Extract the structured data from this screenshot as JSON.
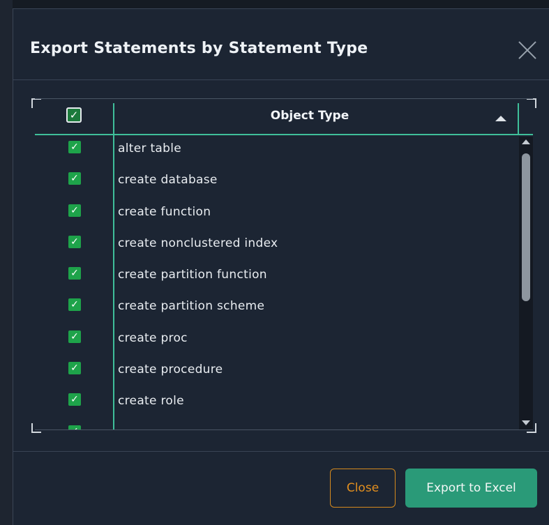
{
  "dialog": {
    "title": "Export Statements by Statement Type",
    "close_icon": "close-x-icon"
  },
  "grid": {
    "select_all_checked": true,
    "column_header": "Object Type",
    "sort_direction": "ascending",
    "rows": [
      {
        "label": "alter table",
        "checked": true
      },
      {
        "label": "create database",
        "checked": true
      },
      {
        "label": "create function",
        "checked": true
      },
      {
        "label": "create nonclustered index",
        "checked": true
      },
      {
        "label": "create partition function",
        "checked": true
      },
      {
        "label": "create partition scheme",
        "checked": true
      },
      {
        "label": "create proc",
        "checked": true
      },
      {
        "label": "create procedure",
        "checked": true
      },
      {
        "label": "create role",
        "checked": true
      },
      {
        "label": "",
        "checked": true
      }
    ]
  },
  "footer": {
    "close_label": "Close",
    "export_label": "Export to Excel"
  },
  "colors": {
    "dialog_bg": "#1c2533",
    "accent_green": "#3fbf9a",
    "checkbox_green": "#1ea34a",
    "close_orange": "#e28f1f",
    "export_bg": "#2a9a78"
  }
}
